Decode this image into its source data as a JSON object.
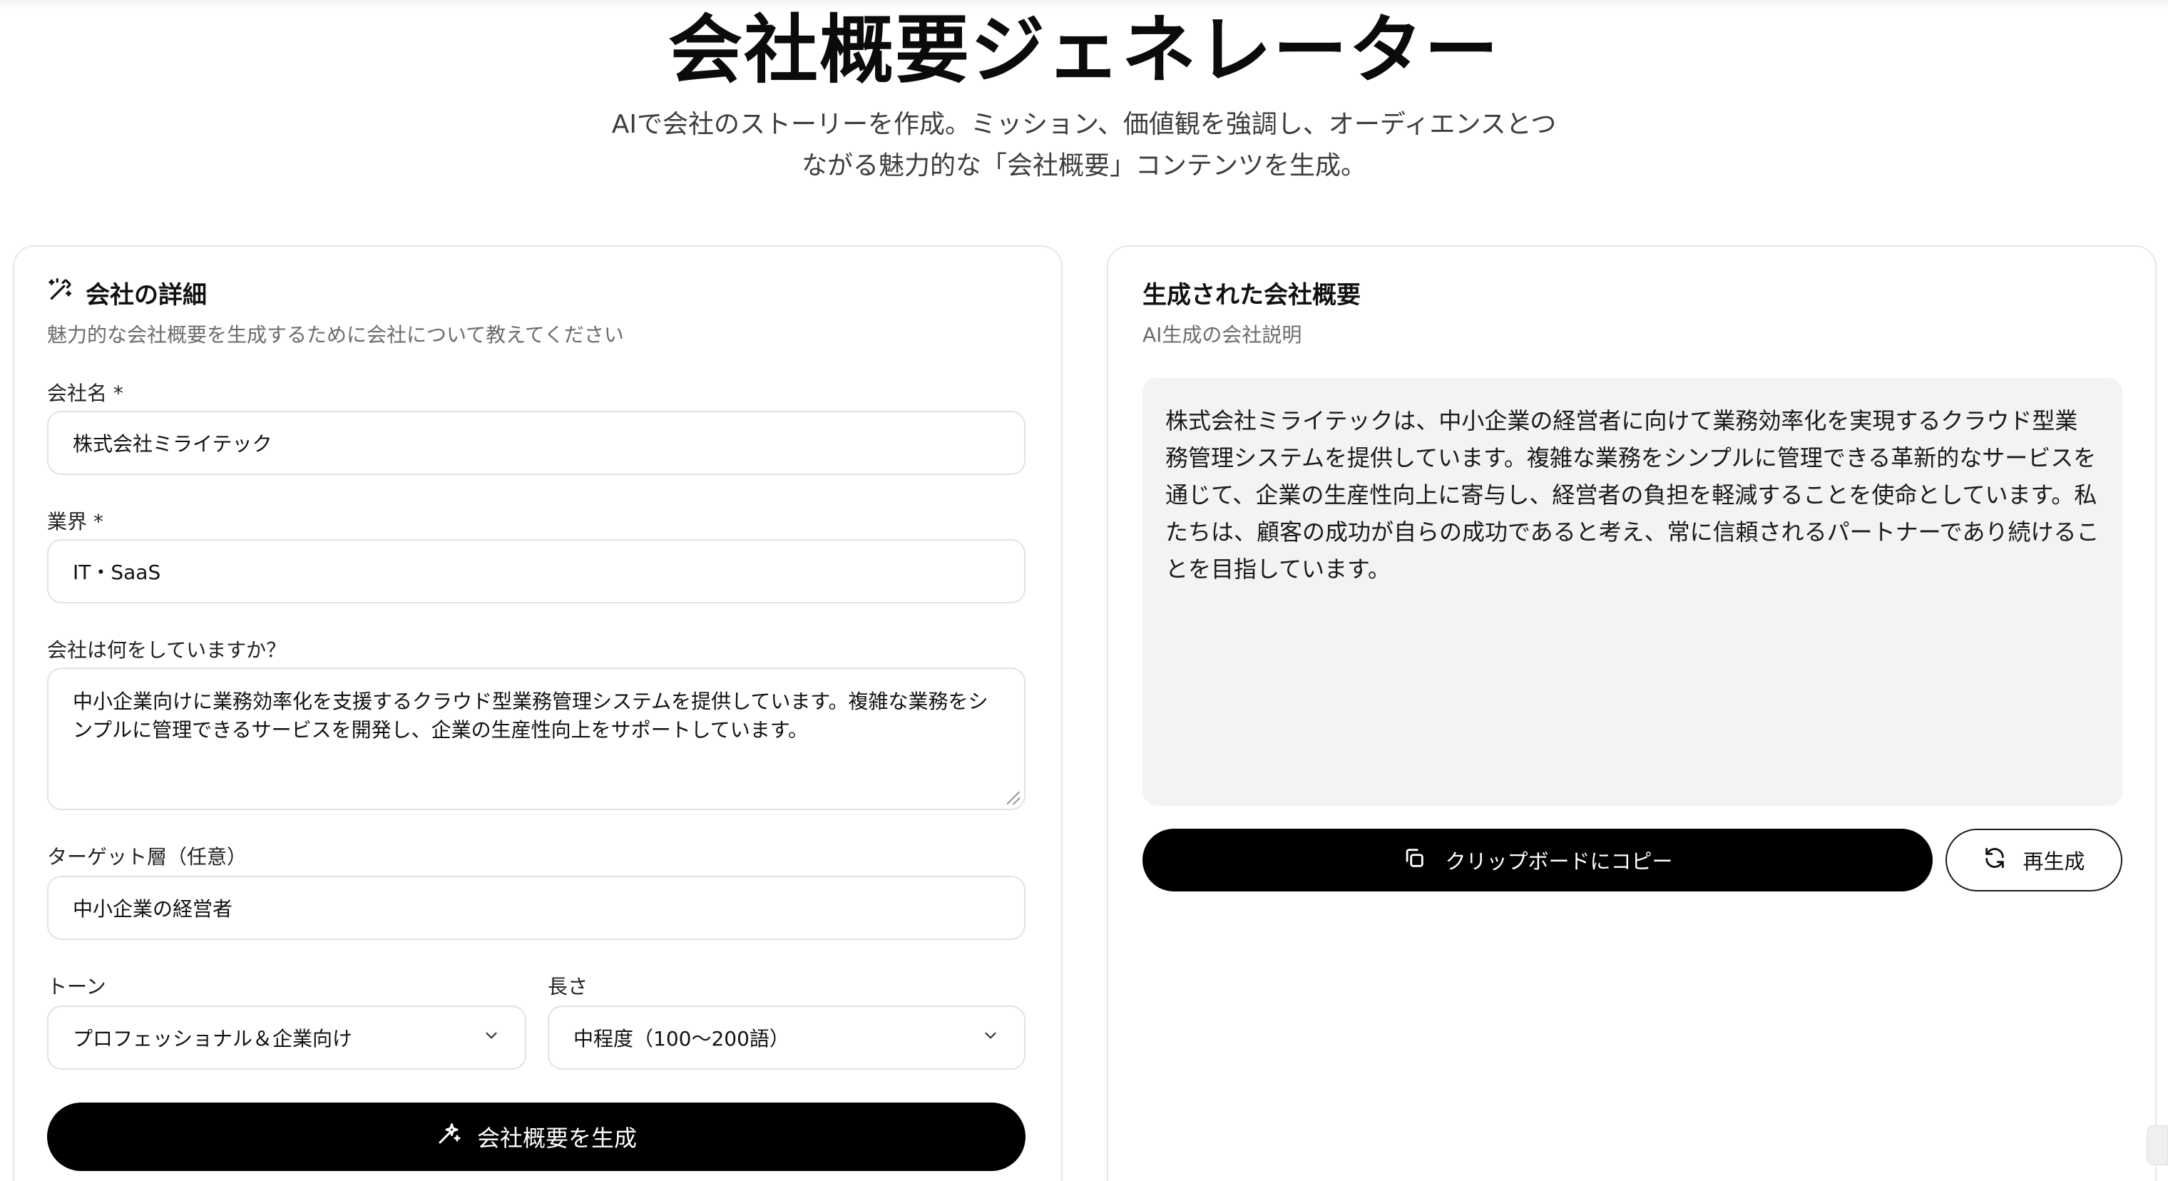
{
  "header": {
    "title": "会社概要ジェネレーター",
    "subtitle_line1": "AIで会社のストーリーを作成。ミッション、価値観を強調し、オーディエンスとつ",
    "subtitle_line2": "ながる魅力的な「会社概要」コンテンツを生成。"
  },
  "form": {
    "icon": "magic-wand-icon",
    "title": "会社の詳細",
    "description": "魅力的な会社概要を生成するために会社について教えてください",
    "company_name": {
      "label": "会社名 *",
      "value": "株式会社ミライテック"
    },
    "industry": {
      "label": "業界 *",
      "value": "IT・SaaS"
    },
    "what_we_do": {
      "label": "会社は何をしていますか？",
      "value": "中小企業向けに業務効率化を支援するクラウド型業務管理システムを提供しています。複雑な業務をシンプルに管理できるサービスを開発し、企業の生産性向上をサポートしています。"
    },
    "target": {
      "label": "ターゲット層（任意）",
      "value": "中小企業の経営者"
    },
    "tone": {
      "label": "トーン",
      "value": "プロフェッショナル＆企業向け"
    },
    "length": {
      "label": "長さ",
      "value": "中程度（100〜200語）"
    },
    "generate_button": "会社概要を生成"
  },
  "output": {
    "title": "生成された会社概要",
    "description": "AI生成の会社説明",
    "text": "株式会社ミライテックは、中小企業の経営者に向けて業務効率化を実現するクラウド型業務管理システムを提供しています。複雑な業務をシンプルに管理できる革新的なサービスを通じて、企業の生産性向上に寄与し、経営者の負担を軽減することを使命としています。私たちは、顧客の成功が自らの成功であると考え、常に信頼されるパートナーであり続けることを目指しています。",
    "copy_button": "クリップボードにコピー",
    "regenerate_button": "再生成"
  }
}
